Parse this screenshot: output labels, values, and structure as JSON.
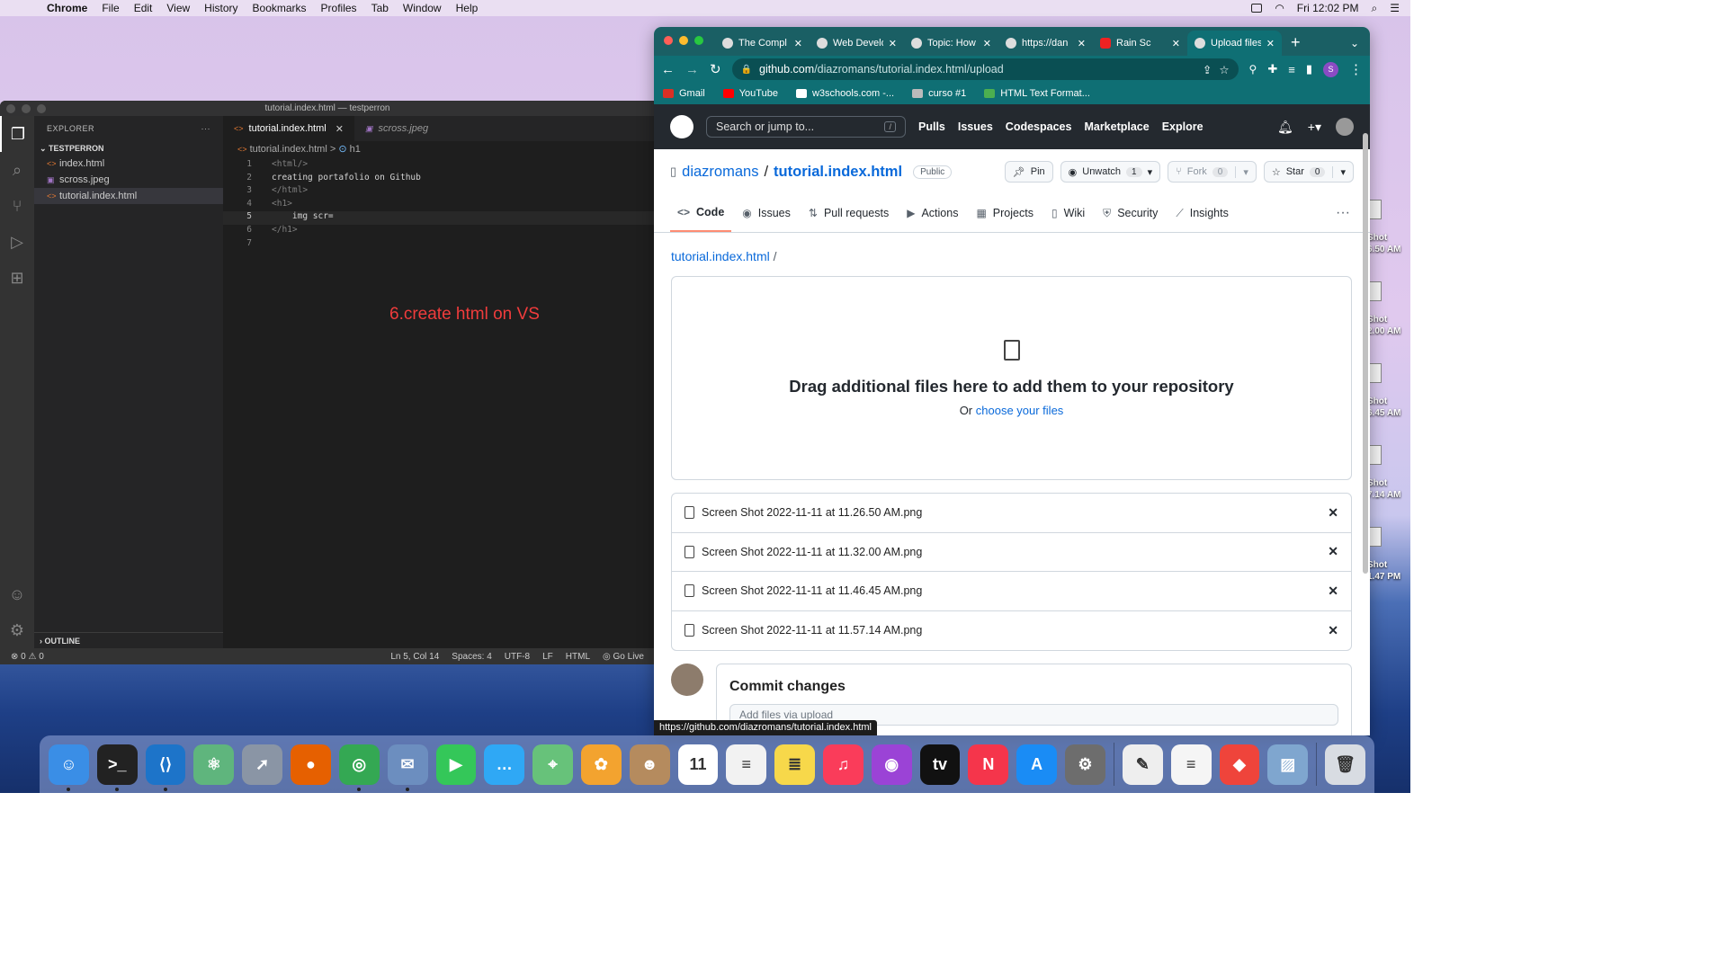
{
  "menubar": {
    "app": "Chrome",
    "items": [
      "File",
      "Edit",
      "View",
      "History",
      "Bookmarks",
      "Profiles",
      "Tab",
      "Window",
      "Help"
    ],
    "clock": "Fri 12:02 PM"
  },
  "desktop_icons": [
    {
      "line1": "Shot",
      "line2": "6.50 AM"
    },
    {
      "line1": "Shot",
      "line2": "2.00 AM"
    },
    {
      "line1": "Shot",
      "line2": "6.45 AM"
    },
    {
      "line1": "Shot",
      "line2": "7.14 AM"
    },
    {
      "line1": "Shot",
      "line2": "1.47 PM"
    }
  ],
  "vscode": {
    "title": "tutorial.index.html — testperron",
    "explorer_label": "EXPLORER",
    "folder": "TESTPERRON",
    "files": [
      "index.html",
      "scross.jpeg",
      "tutorial.index.html"
    ],
    "outline": "OUTLINE",
    "tabs": [
      "tutorial.index.html",
      "scross.jpeg"
    ],
    "breadcrumb_file": "tutorial.index.html",
    "breadcrumb_sep": ">",
    "breadcrumb_symbol": "h1",
    "lines": [
      {
        "n": "1",
        "t": "<html/>"
      },
      {
        "n": "2",
        "t": "creating portafolio on Github"
      },
      {
        "n": "3",
        "t": "</html>"
      },
      {
        "n": "4",
        "t": "<h1>"
      },
      {
        "n": "5",
        "t": "    img scr="
      },
      {
        "n": "6",
        "t": "</h1>"
      },
      {
        "n": "7",
        "t": ""
      }
    ],
    "annotation": "6.create html on VS",
    "status": {
      "problems": "⊗ 0 ⚠ 0",
      "position": "Ln 5, Col 14",
      "spaces": "Spaces: 4",
      "encoding": "UTF-8",
      "eol": "LF",
      "language": "HTML",
      "golive": "Go Live"
    }
  },
  "chrome": {
    "tabs": [
      {
        "label": "The Compl",
        "fav": "star"
      },
      {
        "label": "Web Develo",
        "fav": "w"
      },
      {
        "label": "Topic: How",
        "fav": "dot"
      },
      {
        "label": "https://dan",
        "fav": "globe"
      },
      {
        "label": "Rain Sc",
        "fav": "youtube"
      },
      {
        "label": "Upload files",
        "fav": "github"
      }
    ],
    "url_host": "github.com",
    "url_path": "/diazromans/tutorial.index.html/upload",
    "profile": "S",
    "bookmarks": [
      {
        "label": "Gmail",
        "color": "#d93025"
      },
      {
        "label": "YouTube",
        "color": "#ff0000"
      },
      {
        "label": "w3schools.com -...",
        "color": "#ffffff"
      },
      {
        "label": "curso #1",
        "color": "#bbbbbb"
      },
      {
        "label": "HTML Text Format...",
        "color": "#4caf50"
      }
    ],
    "hover_url": "https://github.com/diazromans/tutorial.index.html"
  },
  "github": {
    "search_placeholder": "Search or jump to...",
    "search_key": "/",
    "nav": [
      "Pulls",
      "Issues",
      "Codespaces",
      "Marketplace",
      "Explore"
    ],
    "owner": "diazromans",
    "slash": "/",
    "repo": "tutorial.index.html",
    "visibility": "Public",
    "pin": "Pin",
    "unwatch": "Unwatch",
    "watch_count": "1",
    "fork": "Fork",
    "fork_count": "0",
    "star": "Star",
    "star_count": "0",
    "tabs": [
      {
        "label": "Code",
        "icon": "<>"
      },
      {
        "label": "Issues",
        "icon": "◉"
      },
      {
        "label": "Pull requests",
        "icon": "⇅"
      },
      {
        "label": "Actions",
        "icon": "▶"
      },
      {
        "label": "Projects",
        "icon": "▦"
      },
      {
        "label": "Wiki",
        "icon": "▯"
      },
      {
        "label": "Security",
        "icon": "⛨"
      },
      {
        "label": "Insights",
        "icon": "⟋"
      }
    ],
    "crumb": "tutorial.index.html",
    "drop_title": "Drag additional files here to add them to your repository",
    "drop_or": "Or ",
    "drop_link": "choose your files",
    "files": [
      "Screen Shot 2022-11-11 at 11.26.50 AM.png",
      "Screen Shot 2022-11-11 at 11.32.00 AM.png",
      "Screen Shot 2022-11-11 at 11.46.45 AM.png",
      "Screen Shot 2022-11-11 at 11.57.14 AM.png"
    ],
    "commit_title": "Commit changes",
    "commit_placeholder": "Add files via upload"
  },
  "dock": {
    "apps": [
      {
        "name": "finder",
        "color": "#3a8ee6",
        "glyph": "☺"
      },
      {
        "name": "terminal",
        "color": "#222222",
        "glyph": ">_"
      },
      {
        "name": "vscode",
        "color": "#1d74c9",
        "glyph": "⟨⟩"
      },
      {
        "name": "atom",
        "color": "#5fb57d",
        "glyph": "⚛"
      },
      {
        "name": "launchpad",
        "color": "#8a95a5",
        "glyph": "➚"
      },
      {
        "name": "firefox",
        "color": "#e66000",
        "glyph": "●"
      },
      {
        "name": "chrome",
        "color": "#34a853",
        "glyph": "◎"
      },
      {
        "name": "preview",
        "color": "#6c8ebf",
        "glyph": "✉"
      },
      {
        "name": "facetime",
        "color": "#34c759",
        "glyph": "▶"
      },
      {
        "name": "messages",
        "color": "#2fa8f5",
        "glyph": "…"
      },
      {
        "name": "maps",
        "color": "#67c27a",
        "glyph": "⌖"
      },
      {
        "name": "photos",
        "color": "#f3a32f",
        "glyph": "✿"
      },
      {
        "name": "contacts",
        "color": "#b58b5e",
        "glyph": "☻"
      },
      {
        "name": "calendar",
        "color": "#ffffff",
        "glyph": "11"
      },
      {
        "name": "reminders",
        "color": "#f2f2f2",
        "glyph": "≡"
      },
      {
        "name": "notes",
        "color": "#f7d84a",
        "glyph": "≣"
      },
      {
        "name": "music",
        "color": "#fa3c5a",
        "glyph": "♫"
      },
      {
        "name": "podcasts",
        "color": "#9b43d6",
        "glyph": "◉"
      },
      {
        "name": "appletv",
        "color": "#111111",
        "glyph": "tv"
      },
      {
        "name": "news",
        "color": "#f5354b",
        "glyph": "N"
      },
      {
        "name": "appstore",
        "color": "#1a8cf5",
        "glyph": "A"
      },
      {
        "name": "system-preferences",
        "color": "#6d6d6d",
        "glyph": "⚙"
      },
      {
        "name": "textedit",
        "color": "#eeeeee",
        "glyph": "✎"
      },
      {
        "name": "text-document",
        "color": "#f5f5f5",
        "glyph": "≡"
      },
      {
        "name": "anydesk",
        "color": "#ef443b",
        "glyph": "◆"
      },
      {
        "name": "image-viewer",
        "color": "#7fa6cf",
        "glyph": "▨"
      },
      {
        "name": "trash",
        "color": "#d8dce2",
        "glyph": "🗑"
      }
    ]
  }
}
